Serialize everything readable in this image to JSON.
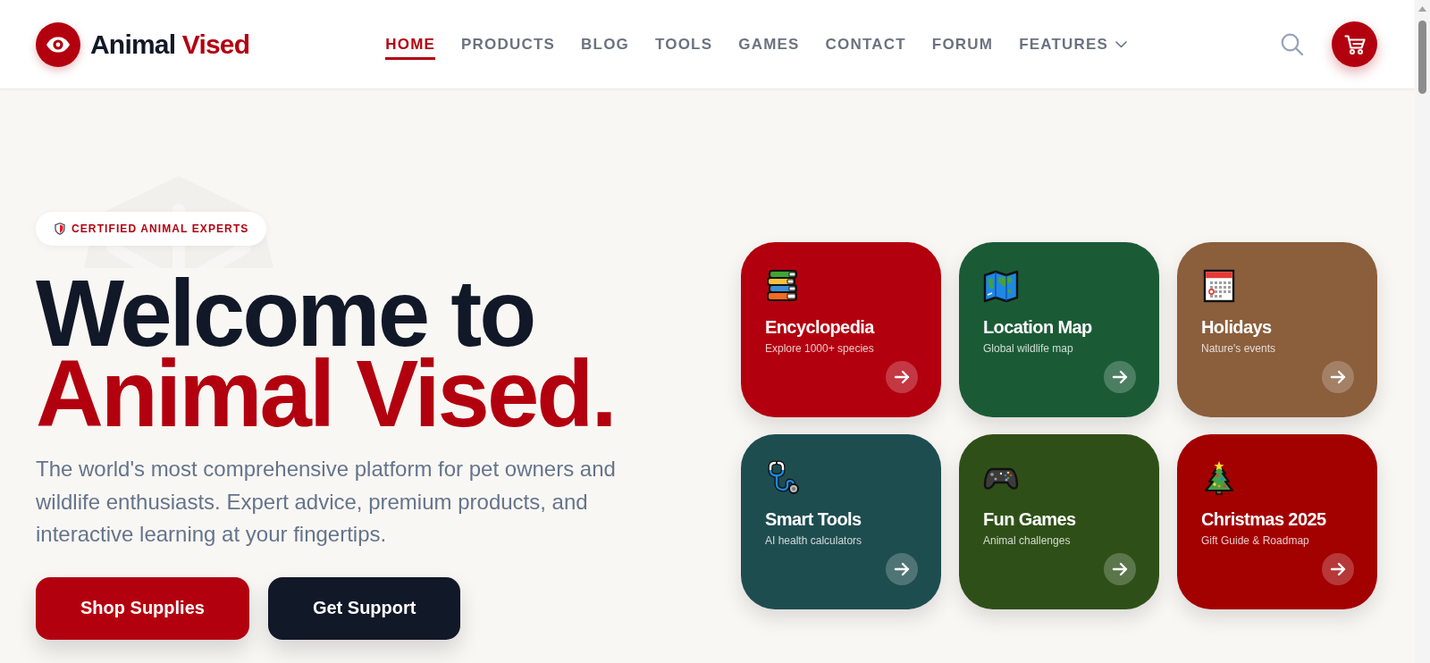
{
  "logo": {
    "name": "Animal",
    "accent": "Vised"
  },
  "nav": [
    {
      "label": "HOME",
      "selected": true,
      "kind": "link"
    },
    {
      "label": "PRODUCTS",
      "selected": false,
      "kind": "link"
    },
    {
      "label": "BLOG",
      "selected": false,
      "kind": "link"
    },
    {
      "label": "TOOLS",
      "selected": false,
      "kind": "link"
    },
    {
      "label": "GAMES",
      "selected": false,
      "kind": "link"
    },
    {
      "label": "CONTACT",
      "selected": false,
      "kind": "link"
    },
    {
      "label": "FORUM",
      "selected": false,
      "kind": "link"
    },
    {
      "label": "FEATURES",
      "selected": false,
      "kind": "dropdown"
    }
  ],
  "hero": {
    "badge": "CERTIFIED ANIMAL EXPERTS",
    "title": "Welcome to",
    "title_accent": "Animal Vised.",
    "description": "The world's most comprehensive platform for pet owners and wildlife enthusiasts. Expert advice, premium products, and interactive learning at your fingertips.",
    "buttons": [
      {
        "label": "Shop Supplies",
        "kind": "primary"
      },
      {
        "label": "Get Support",
        "kind": "secondary"
      }
    ]
  },
  "cards": [
    {
      "title": "Encyclopedia",
      "subtitle": "Explore 1000+ species",
      "color": "#b3000f"
    },
    {
      "title": "Location Map",
      "subtitle": "Global wildlife map",
      "color": "#1a5b36"
    },
    {
      "title": "Holidays",
      "subtitle": "Nature's events",
      "color": "#8b5e3c"
    },
    {
      "title": "Smart Tools",
      "subtitle": "AI health calculators",
      "color": "#1e4d50"
    },
    {
      "title": "Fun Games",
      "subtitle": "Animal challenges",
      "color": "#2e5018"
    },
    {
      "title": "Christmas 2025",
      "subtitle": "Gift Guide & Roadmap",
      "color": "#a30000"
    }
  ]
}
